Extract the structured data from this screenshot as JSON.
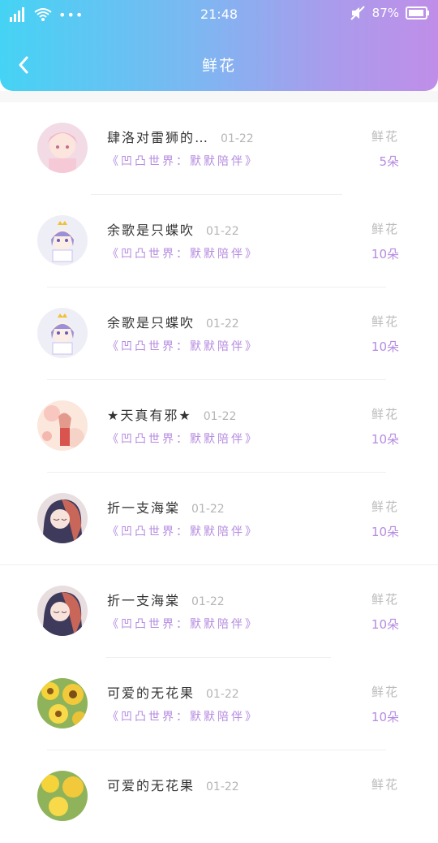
{
  "status": {
    "time": "21:48",
    "battery": "87%"
  },
  "header": {
    "title": "鲜花"
  },
  "items": [
    {
      "name": "肆洛对雷狮的…",
      "date": "01-22",
      "subtitle": "《凹凸世界：默默陪伴》",
      "type": "鲜花",
      "count": "5朵"
    },
    {
      "name": "余歌是只蝶吹",
      "date": "01-22",
      "subtitle": "《凹凸世界：默默陪伴》",
      "type": "鲜花",
      "count": "10朵"
    },
    {
      "name": "余歌是只蝶吹",
      "date": "01-22",
      "subtitle": "《凹凸世界：默默陪伴》",
      "type": "鲜花",
      "count": "10朵"
    },
    {
      "name": "★天真有邪★",
      "date": "01-22",
      "subtitle": "《凹凸世界：默默陪伴》",
      "type": "鲜花",
      "count": "10朵"
    },
    {
      "name": "折一支海棠",
      "date": "01-22",
      "subtitle": "《凹凸世界：默默陪伴》",
      "type": "鲜花",
      "count": "10朵"
    },
    {
      "name": "折一支海棠",
      "date": "01-22",
      "subtitle": "《凹凸世界：默默陪伴》",
      "type": "鲜花",
      "count": "10朵"
    },
    {
      "name": "可爱的无花果",
      "date": "01-22",
      "subtitle": "《凹凸世界：默默陪伴》",
      "type": "鲜花",
      "count": "10朵"
    },
    {
      "name": "可爱的无花果",
      "date": "01-22",
      "subtitle": "",
      "type": "鲜花",
      "count": ""
    }
  ],
  "colors": {
    "accent": "#b58be0",
    "gradient_start": "#45d3f4",
    "gradient_end": "#c08ee8"
  }
}
